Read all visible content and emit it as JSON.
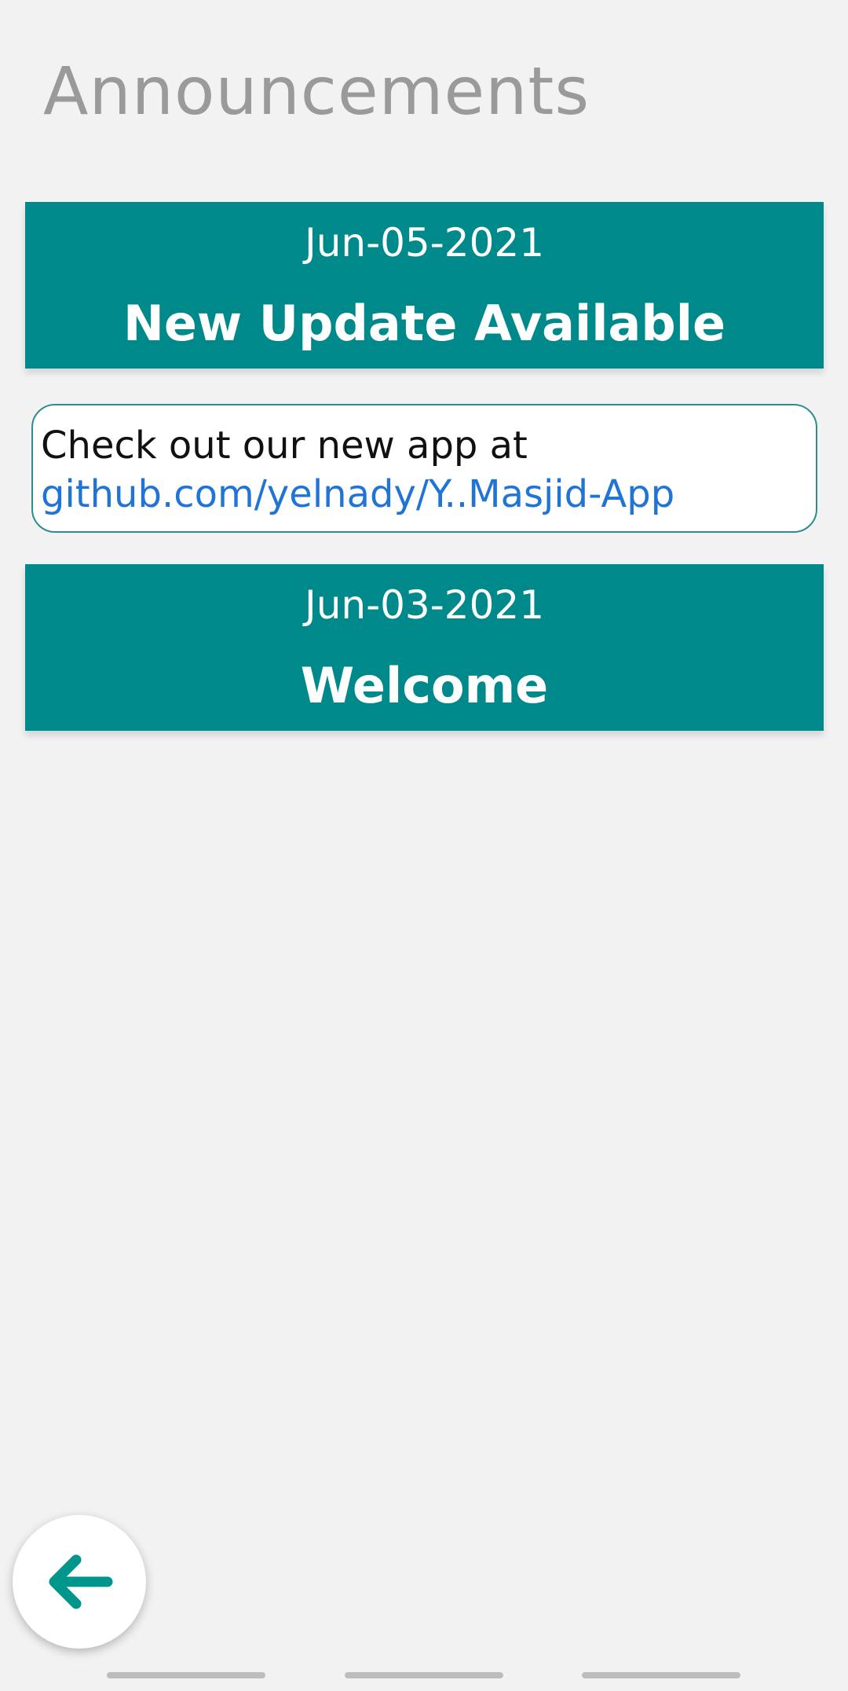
{
  "header": {
    "title": "Announcements"
  },
  "announcements": [
    {
      "date": "Jun-05-2021",
      "title": "New Update Available",
      "body_text": "Check out our new app at ",
      "link_text": "github.com/yelnady/Y..Masjid-App"
    },
    {
      "date": "Jun-03-2021",
      "title": "Welcome"
    }
  ],
  "colors": {
    "accent": "#00898A",
    "link": "#1F74D6",
    "title_gray": "#9A9A9A",
    "background": "#F2F2F2"
  },
  "fab": {
    "icon": "arrow-left-icon"
  }
}
